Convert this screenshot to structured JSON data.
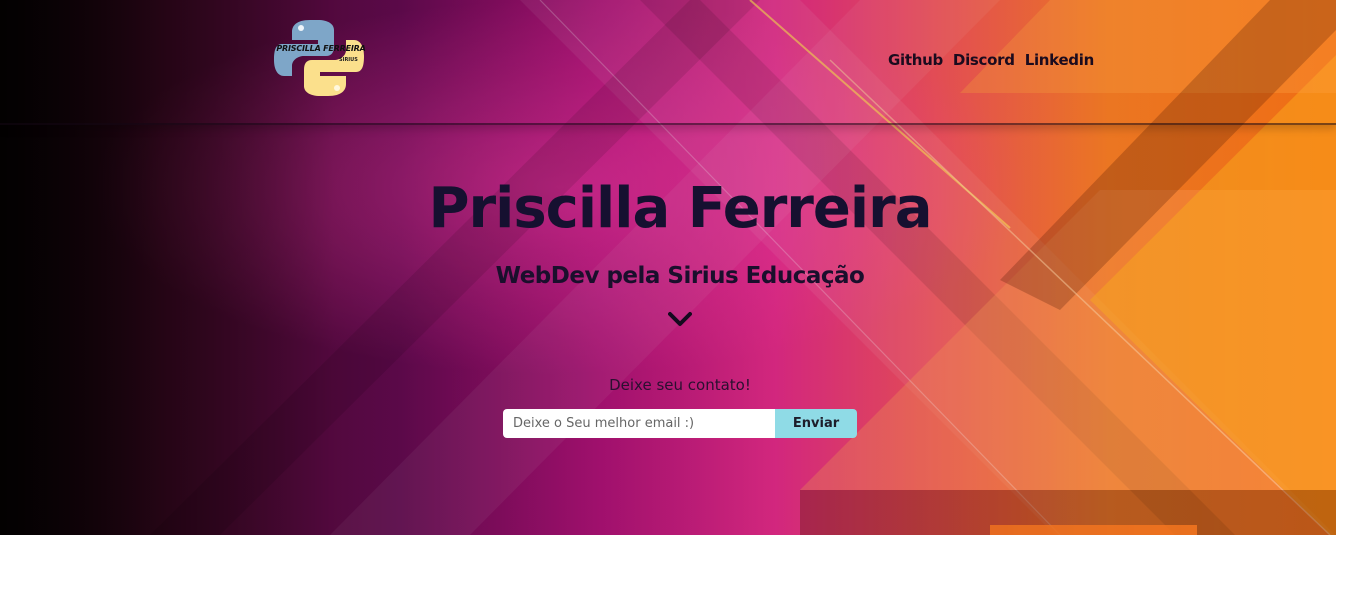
{
  "header": {
    "logo": {
      "text": "PRISCILLA FERREIRA",
      "subtext": "SIRIUS",
      "icon": "python-logo-icon"
    },
    "nav": [
      {
        "label": "Github"
      },
      {
        "label": "Discord"
      },
      {
        "label": "Linkedin"
      }
    ]
  },
  "hero": {
    "title": "Priscilla Ferreira",
    "subtitle": "WebDev pela Sirius Educação",
    "scroll_icon": "chevron-down-icon"
  },
  "contact": {
    "label": "Deixe seu contato!",
    "email_placeholder": "Deixe o Seu melhor email :)",
    "email_value": "",
    "submit_label": "Enviar"
  },
  "colors": {
    "button_bg": "#8fdbe6",
    "title_text": "#161030",
    "nav_text": "#1b0b1e",
    "hero_gradient": [
      "#120507",
      "#6a0a55",
      "#e52a89",
      "#f37a23"
    ]
  }
}
